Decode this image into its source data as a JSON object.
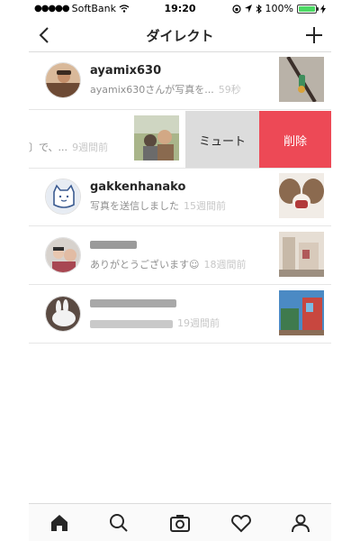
{
  "status_bar": {
    "carrier": "SoftBank",
    "time": "19:20",
    "battery": "100%"
  },
  "nav": {
    "title": "ダイレクト",
    "back_icon": "chevron-left-icon",
    "new_icon": "plus-icon"
  },
  "threads": [
    {
      "name": "ayamix630",
      "preview": "ayamix630さんが写真を...",
      "time": "59秒"
    },
    {
      "preview": "〕で、...",
      "time": "9週間前",
      "swiped": true
    },
    {
      "name": "gakkenhanako",
      "preview": "写真を送信しました",
      "time": "15週間前"
    },
    {
      "preview": "ありがとうございます☺",
      "time": "18週間前"
    },
    {
      "time": "19週間前"
    }
  ],
  "swipe_actions": {
    "mute": "ミュート",
    "delete": "削除"
  },
  "colors": {
    "delete": "#ed4956",
    "mute": "#dcdcdc",
    "battery": "#4cd964"
  },
  "tab_bar": [
    "home-icon",
    "search-icon",
    "camera-icon",
    "heart-icon",
    "profile-icon"
  ]
}
